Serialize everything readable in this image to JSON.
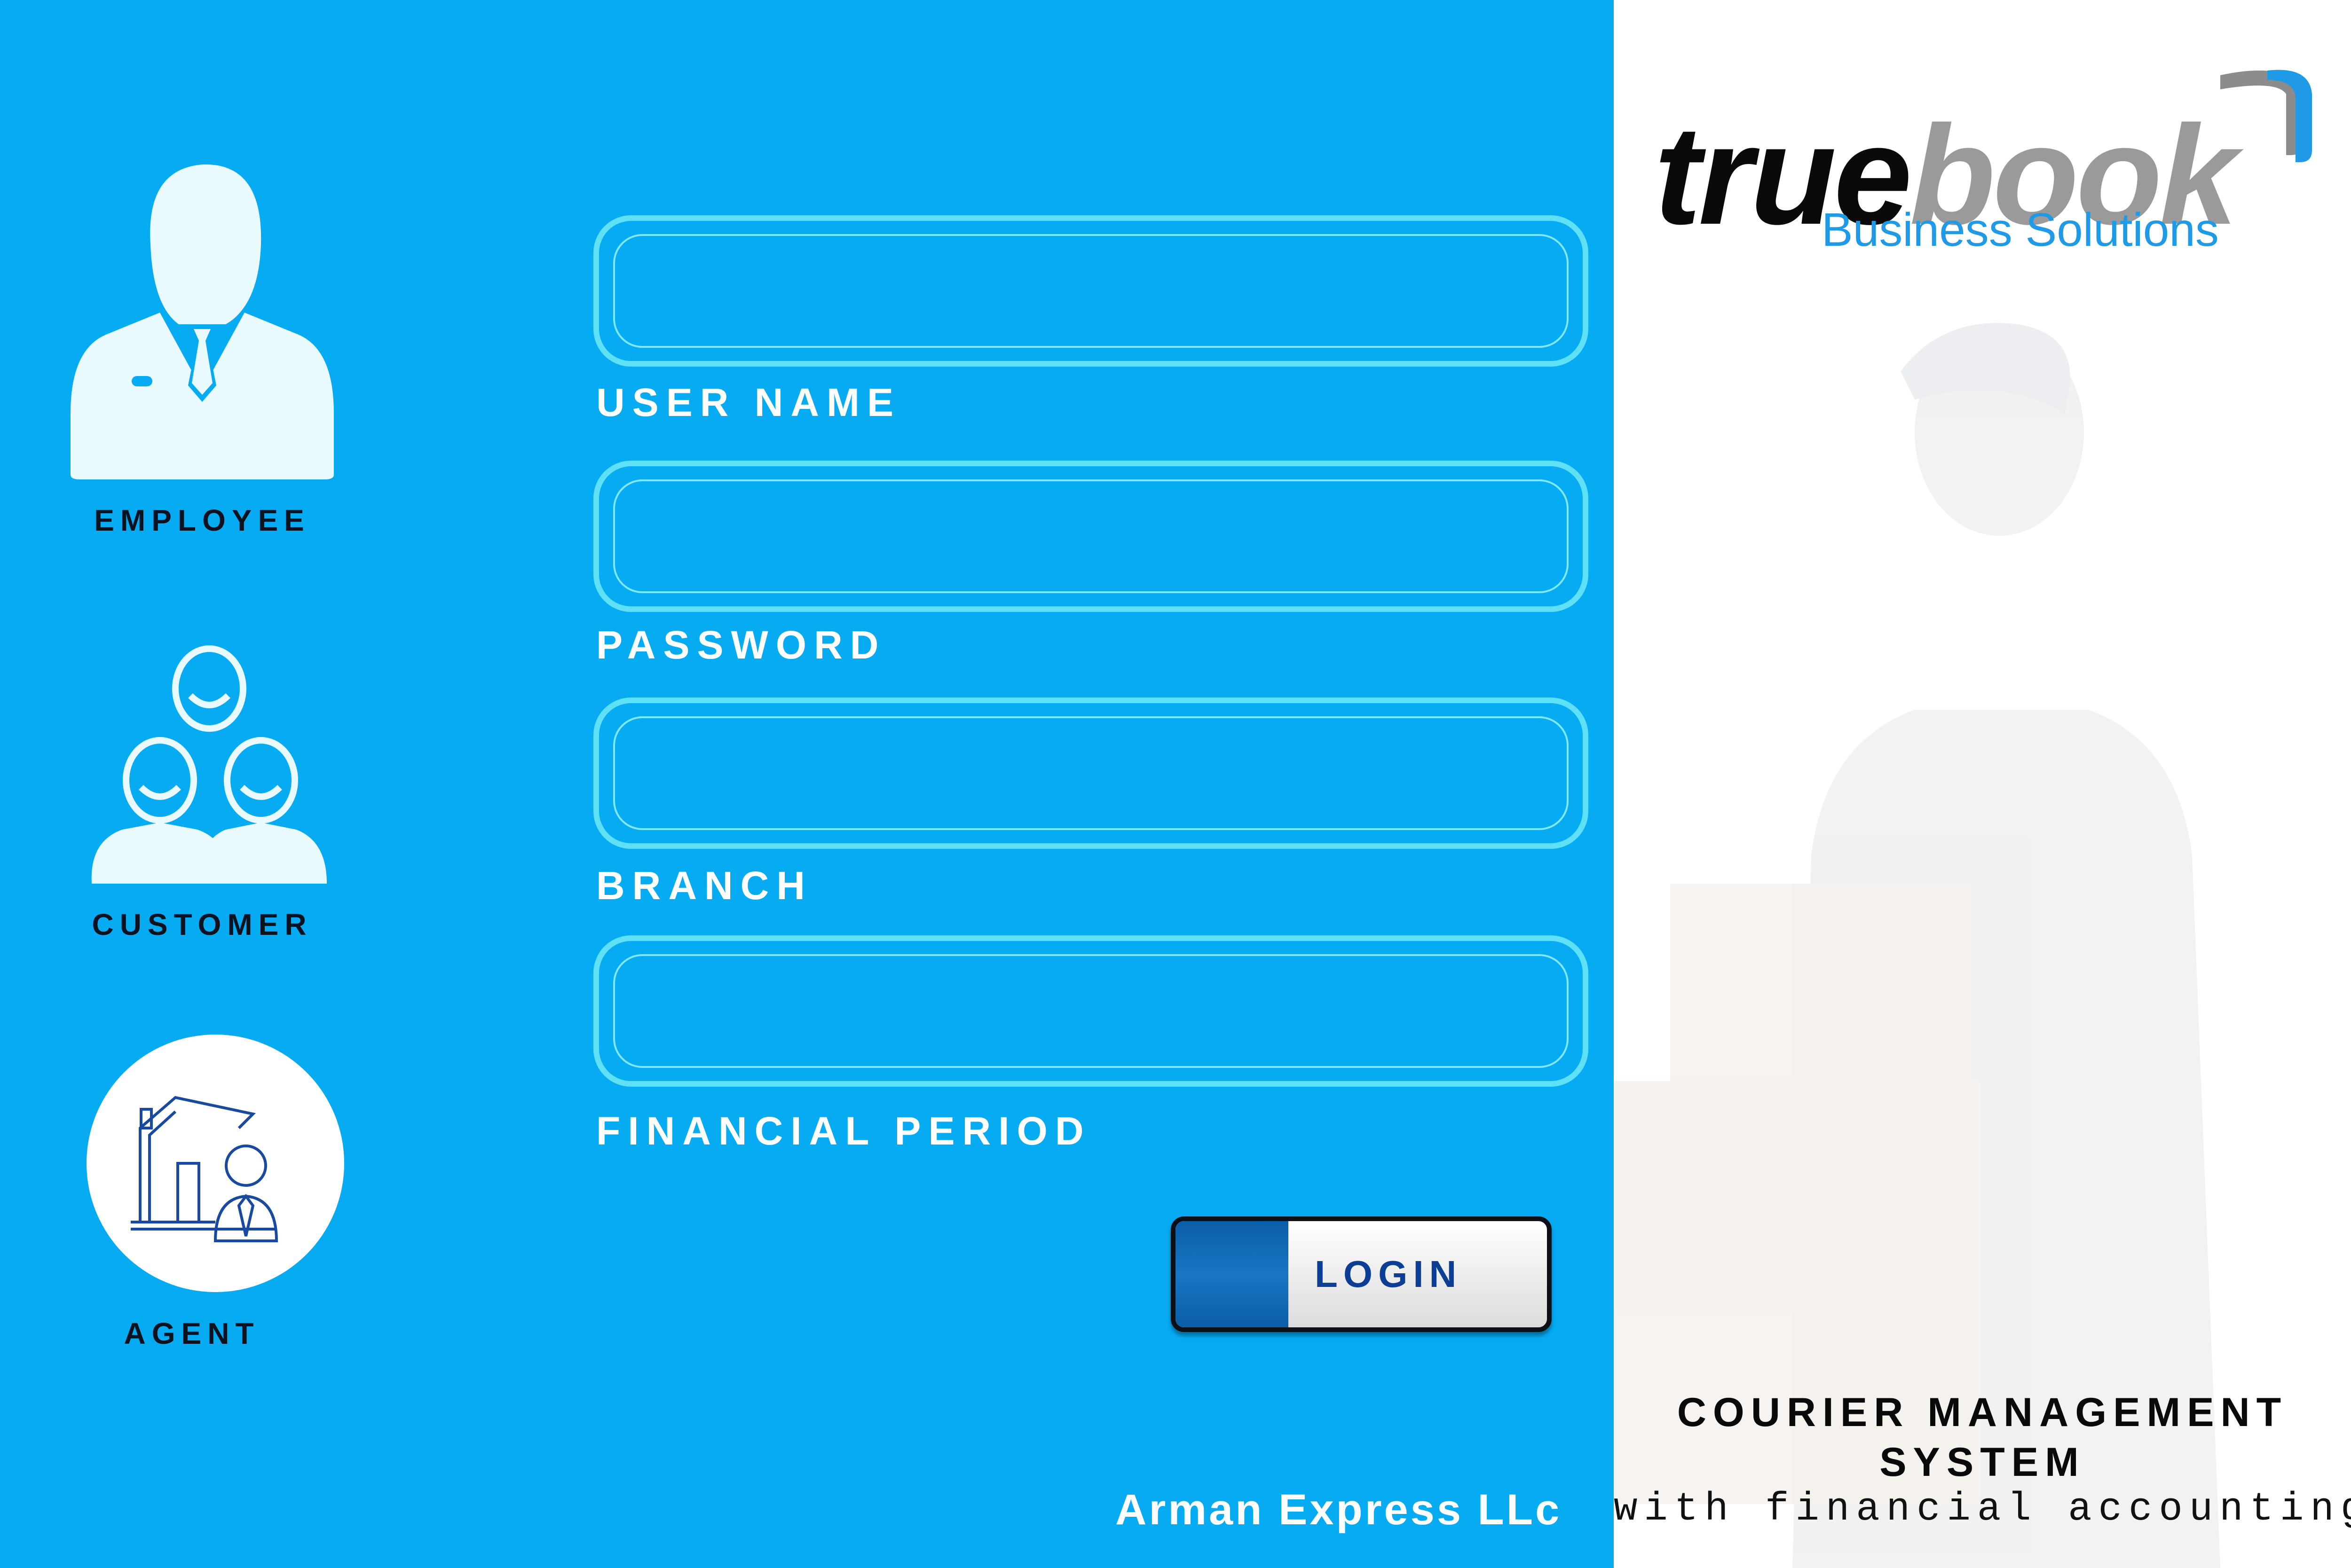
{
  "roles": [
    {
      "label": "EMPLOYEE",
      "icon": "employee-icon"
    },
    {
      "label": "CUSTOMER",
      "icon": "customers-group-icon"
    },
    {
      "label": "AGENT",
      "icon": "agent-house-icon"
    }
  ],
  "form": {
    "fields": [
      {
        "label": "USER NAME",
        "value": ""
      },
      {
        "label": "PASSWORD",
        "value": ""
      },
      {
        "label": "BRANCH",
        "value": ""
      },
      {
        "label": "FINANCIAL PERIOD",
        "value": ""
      }
    ],
    "login_label": "LOGIN"
  },
  "company": "Arman Express LLc",
  "brand": {
    "name_dark": "true",
    "name_light": "book",
    "tagline": "Business Solutions"
  },
  "system": {
    "line1": "COURIER MANAGEMENT",
    "line2": "SYSTEM",
    "line3": "with financial accounting"
  },
  "colors": {
    "panel": "#06abf2",
    "field_border": "#5ee0f7",
    "login_accent": "#0a5ea8",
    "brand_blue": "#1e9ae6"
  }
}
